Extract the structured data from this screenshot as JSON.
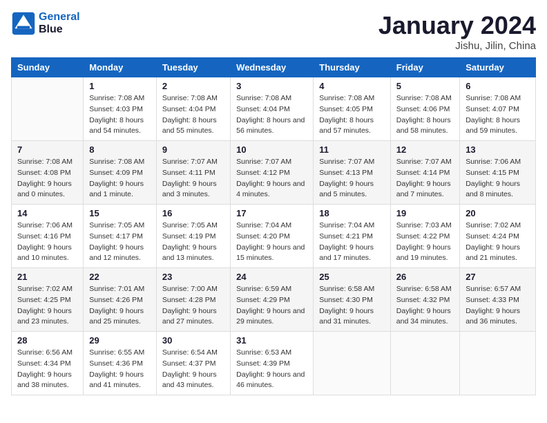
{
  "header": {
    "logo_line1": "General",
    "logo_line2": "Blue",
    "month": "January 2024",
    "location": "Jishu, Jilin, China"
  },
  "weekdays": [
    "Sunday",
    "Monday",
    "Tuesday",
    "Wednesday",
    "Thursday",
    "Friday",
    "Saturday"
  ],
  "weeks": [
    [
      {
        "day": "",
        "sunrise": "",
        "sunset": "",
        "daylight": ""
      },
      {
        "day": "1",
        "sunrise": "Sunrise: 7:08 AM",
        "sunset": "Sunset: 4:03 PM",
        "daylight": "Daylight: 8 hours and 54 minutes."
      },
      {
        "day": "2",
        "sunrise": "Sunrise: 7:08 AM",
        "sunset": "Sunset: 4:04 PM",
        "daylight": "Daylight: 8 hours and 55 minutes."
      },
      {
        "day": "3",
        "sunrise": "Sunrise: 7:08 AM",
        "sunset": "Sunset: 4:04 PM",
        "daylight": "Daylight: 8 hours and 56 minutes."
      },
      {
        "day": "4",
        "sunrise": "Sunrise: 7:08 AM",
        "sunset": "Sunset: 4:05 PM",
        "daylight": "Daylight: 8 hours and 57 minutes."
      },
      {
        "day": "5",
        "sunrise": "Sunrise: 7:08 AM",
        "sunset": "Sunset: 4:06 PM",
        "daylight": "Daylight: 8 hours and 58 minutes."
      },
      {
        "day": "6",
        "sunrise": "Sunrise: 7:08 AM",
        "sunset": "Sunset: 4:07 PM",
        "daylight": "Daylight: 8 hours and 59 minutes."
      }
    ],
    [
      {
        "day": "7",
        "sunrise": "Sunrise: 7:08 AM",
        "sunset": "Sunset: 4:08 PM",
        "daylight": "Daylight: 9 hours and 0 minutes."
      },
      {
        "day": "8",
        "sunrise": "Sunrise: 7:08 AM",
        "sunset": "Sunset: 4:09 PM",
        "daylight": "Daylight: 9 hours and 1 minute."
      },
      {
        "day": "9",
        "sunrise": "Sunrise: 7:07 AM",
        "sunset": "Sunset: 4:11 PM",
        "daylight": "Daylight: 9 hours and 3 minutes."
      },
      {
        "day": "10",
        "sunrise": "Sunrise: 7:07 AM",
        "sunset": "Sunset: 4:12 PM",
        "daylight": "Daylight: 9 hours and 4 minutes."
      },
      {
        "day": "11",
        "sunrise": "Sunrise: 7:07 AM",
        "sunset": "Sunset: 4:13 PM",
        "daylight": "Daylight: 9 hours and 5 minutes."
      },
      {
        "day": "12",
        "sunrise": "Sunrise: 7:07 AM",
        "sunset": "Sunset: 4:14 PM",
        "daylight": "Daylight: 9 hours and 7 minutes."
      },
      {
        "day": "13",
        "sunrise": "Sunrise: 7:06 AM",
        "sunset": "Sunset: 4:15 PM",
        "daylight": "Daylight: 9 hours and 8 minutes."
      }
    ],
    [
      {
        "day": "14",
        "sunrise": "Sunrise: 7:06 AM",
        "sunset": "Sunset: 4:16 PM",
        "daylight": "Daylight: 9 hours and 10 minutes."
      },
      {
        "day": "15",
        "sunrise": "Sunrise: 7:05 AM",
        "sunset": "Sunset: 4:17 PM",
        "daylight": "Daylight: 9 hours and 12 minutes."
      },
      {
        "day": "16",
        "sunrise": "Sunrise: 7:05 AM",
        "sunset": "Sunset: 4:19 PM",
        "daylight": "Daylight: 9 hours and 13 minutes."
      },
      {
        "day": "17",
        "sunrise": "Sunrise: 7:04 AM",
        "sunset": "Sunset: 4:20 PM",
        "daylight": "Daylight: 9 hours and 15 minutes."
      },
      {
        "day": "18",
        "sunrise": "Sunrise: 7:04 AM",
        "sunset": "Sunset: 4:21 PM",
        "daylight": "Daylight: 9 hours and 17 minutes."
      },
      {
        "day": "19",
        "sunrise": "Sunrise: 7:03 AM",
        "sunset": "Sunset: 4:22 PM",
        "daylight": "Daylight: 9 hours and 19 minutes."
      },
      {
        "day": "20",
        "sunrise": "Sunrise: 7:02 AM",
        "sunset": "Sunset: 4:24 PM",
        "daylight": "Daylight: 9 hours and 21 minutes."
      }
    ],
    [
      {
        "day": "21",
        "sunrise": "Sunrise: 7:02 AM",
        "sunset": "Sunset: 4:25 PM",
        "daylight": "Daylight: 9 hours and 23 minutes."
      },
      {
        "day": "22",
        "sunrise": "Sunrise: 7:01 AM",
        "sunset": "Sunset: 4:26 PM",
        "daylight": "Daylight: 9 hours and 25 minutes."
      },
      {
        "day": "23",
        "sunrise": "Sunrise: 7:00 AM",
        "sunset": "Sunset: 4:28 PM",
        "daylight": "Daylight: 9 hours and 27 minutes."
      },
      {
        "day": "24",
        "sunrise": "Sunrise: 6:59 AM",
        "sunset": "Sunset: 4:29 PM",
        "daylight": "Daylight: 9 hours and 29 minutes."
      },
      {
        "day": "25",
        "sunrise": "Sunrise: 6:58 AM",
        "sunset": "Sunset: 4:30 PM",
        "daylight": "Daylight: 9 hours and 31 minutes."
      },
      {
        "day": "26",
        "sunrise": "Sunrise: 6:58 AM",
        "sunset": "Sunset: 4:32 PM",
        "daylight": "Daylight: 9 hours and 34 minutes."
      },
      {
        "day": "27",
        "sunrise": "Sunrise: 6:57 AM",
        "sunset": "Sunset: 4:33 PM",
        "daylight": "Daylight: 9 hours and 36 minutes."
      }
    ],
    [
      {
        "day": "28",
        "sunrise": "Sunrise: 6:56 AM",
        "sunset": "Sunset: 4:34 PM",
        "daylight": "Daylight: 9 hours and 38 minutes."
      },
      {
        "day": "29",
        "sunrise": "Sunrise: 6:55 AM",
        "sunset": "Sunset: 4:36 PM",
        "daylight": "Daylight: 9 hours and 41 minutes."
      },
      {
        "day": "30",
        "sunrise": "Sunrise: 6:54 AM",
        "sunset": "Sunset: 4:37 PM",
        "daylight": "Daylight: 9 hours and 43 minutes."
      },
      {
        "day": "31",
        "sunrise": "Sunrise: 6:53 AM",
        "sunset": "Sunset: 4:39 PM",
        "daylight": "Daylight: 9 hours and 46 minutes."
      },
      {
        "day": "",
        "sunrise": "",
        "sunset": "",
        "daylight": ""
      },
      {
        "day": "",
        "sunrise": "",
        "sunset": "",
        "daylight": ""
      },
      {
        "day": "",
        "sunrise": "",
        "sunset": "",
        "daylight": ""
      }
    ]
  ]
}
